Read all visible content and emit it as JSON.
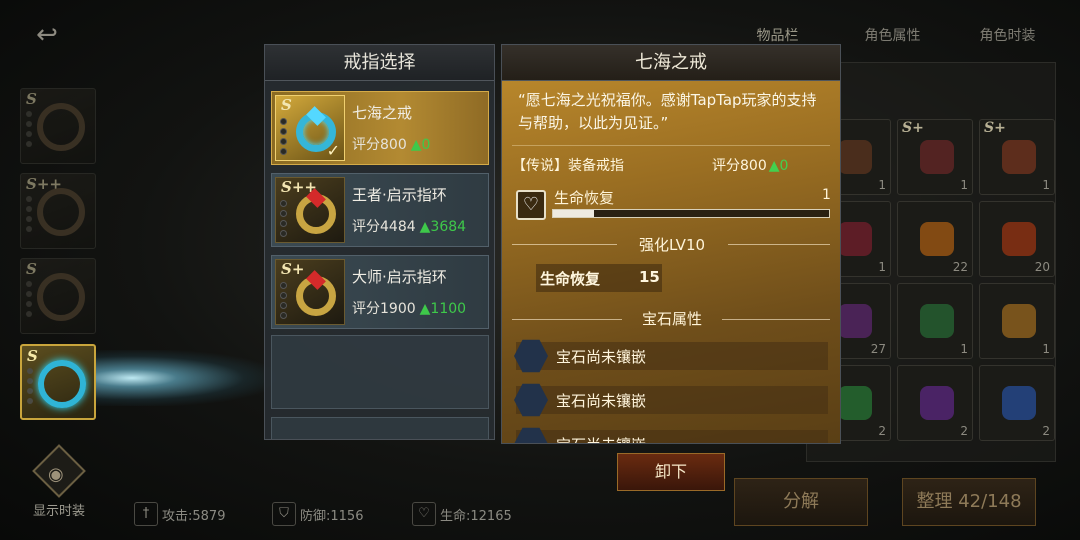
{
  "background": {
    "back_icon": "back-arrow-icon",
    "left_slots": [
      {
        "grade": "S"
      },
      {
        "grade": "S++"
      },
      {
        "grade": "S"
      },
      {
        "grade": "S",
        "active": true
      }
    ],
    "show_fashion_label": "显示时装",
    "stats": [
      {
        "icon": "sword-icon",
        "text": "攻击:5879"
      },
      {
        "icon": "shield-icon",
        "text": "防御:1156"
      },
      {
        "icon": "heart-icon",
        "text": "生命:12165"
      }
    ],
    "inventory_tabs": [
      "物品栏",
      "角色属性",
      "角色时装"
    ],
    "inventory_cells": [
      {
        "grade": "",
        "count": "1",
        "color": "#6a3b20"
      },
      {
        "grade": "S+",
        "count": "1",
        "color": "#7a2a2a"
      },
      {
        "grade": "S+",
        "count": "1",
        "color": "#8a3a20"
      },
      {
        "grade": "",
        "count": "1",
        "color": "#8a2030"
      },
      {
        "grade": "",
        "count": "22",
        "color": "#c86a10"
      },
      {
        "grade": "",
        "count": "20",
        "color": "#b83a10"
      },
      {
        "grade": "",
        "count": "27",
        "color": "#6a2a80"
      },
      {
        "grade": "",
        "count": "1",
        "color": "#2a7a3a"
      },
      {
        "grade": "",
        "count": "1",
        "color": "#b87a20"
      },
      {
        "grade": "",
        "count": "2",
        "color": "#2a8a3a"
      },
      {
        "grade": "",
        "count": "2",
        "color": "#6a2a9a"
      },
      {
        "grade": "",
        "count": "2",
        "color": "#2a5ab8"
      }
    ],
    "decompose_label": "分解",
    "sort_label": "整理 42/148"
  },
  "ring_panel": {
    "title": "戒指选择",
    "items": [
      {
        "grade": "S",
        "name": "七海之戒",
        "score_label": "评分800",
        "delta": "0",
        "selected": true,
        "style": "blue"
      },
      {
        "grade": "S++",
        "name": "王者·启示指环",
        "score_label": "评分4484",
        "delta": "3684",
        "selected": false,
        "style": "red"
      },
      {
        "grade": "S+",
        "name": "大师·启示指环",
        "score_label": "评分1900",
        "delta": "1100",
        "selected": false,
        "style": "red"
      }
    ]
  },
  "detail": {
    "title": "七海之戒",
    "quote": "“愿七海之光祝福你。感谢TapTap玩家的支持与帮助，以此为见证。”",
    "equip_type": "【传说】装备戒指",
    "score_label": "评分800",
    "delta": "0",
    "hp_name": "生命恢复",
    "hp_value": "1",
    "hp_fill_percent": 15,
    "enhance_title": "强化LV10",
    "enhance_stat_name": "生命恢复",
    "enhance_stat_value": "15",
    "gem_title": "宝石属性",
    "gem_slots": [
      "宝石尚未镶嵌",
      "宝石尚未镶嵌",
      "宝石尚未镶嵌"
    ]
  },
  "unequip_label": "卸下"
}
